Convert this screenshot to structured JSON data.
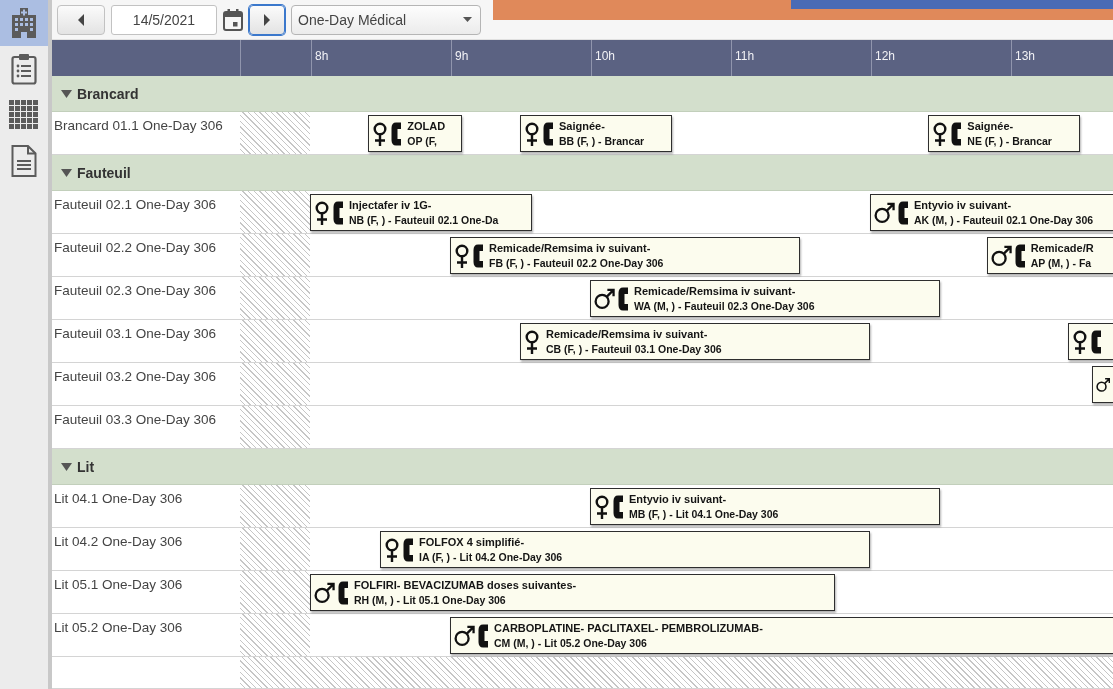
{
  "sidebar": {
    "items": [
      {
        "selected": true
      },
      {
        "selected": false
      },
      {
        "selected": false
      },
      {
        "selected": false
      }
    ]
  },
  "toolbar": {
    "date": "14/5/2021",
    "next_focused": true,
    "unit": "One-Day Médical"
  },
  "timeline": {
    "hours": [
      "8h",
      "9h",
      "10h",
      "11h",
      "12h",
      "13h"
    ]
  },
  "groups": [
    {
      "title": "Brancard",
      "expanded": true,
      "rows": [
        {
          "label": "Brancard 01.1 One-Day 306",
          "unavailable": false,
          "events": [
            {
              "kind": "female",
              "phone": true,
              "title": "ZOLAD",
              "detail": "OP (F,"
            },
            {
              "kind": "female",
              "phone": true,
              "title": "Saignée-",
              "detail": "BB (F, ) - Brancar"
            },
            {
              "kind": "female",
              "phone": true,
              "title": "Saignée-",
              "detail": "NE (F, ) - Brancar"
            }
          ]
        }
      ]
    },
    {
      "title": "Fauteuil",
      "expanded": true,
      "rows": [
        {
          "label": "Fauteuil 02.1 One-Day 306",
          "unavailable": false,
          "events": [
            {
              "kind": "female",
              "phone": true,
              "title": "Injectafer iv 1G-",
              "detail": "NB (F, ) - Fauteuil 02.1 One-Da"
            },
            {
              "kind": "male",
              "phone": true,
              "title": "Entyvio iv suivant-",
              "detail": "AK (M, ) - Fauteuil 02.1 One-Day 306"
            }
          ]
        },
        {
          "label": "Fauteuil 02.2 One-Day 306",
          "unavailable": false,
          "events": [
            {
              "kind": "female",
              "phone": true,
              "title": "Remicade/Remsima iv suivant-",
              "detail": "FB (F, ) - Fauteuil 02.2 One-Day 306"
            },
            {
              "kind": "male",
              "phone": true,
              "title": "Remicade/R",
              "detail": "AP (M, ) - Fa"
            }
          ]
        },
        {
          "label": "Fauteuil 02.3 One-Day 306",
          "unavailable": false,
          "events": [
            {
              "kind": "male",
              "phone": true,
              "title": "Remicade/Remsima iv suivant-",
              "detail": "WA (M, ) - Fauteuil 02.3 One-Day 306"
            }
          ]
        },
        {
          "label": "Fauteuil 03.1 One-Day 306",
          "unavailable": false,
          "events": [
            {
              "kind": "female",
              "phone": false,
              "title": "Remicade/Remsima iv suivant-",
              "detail": "CB (F, ) - Fauteuil 03.1 One-Day 306"
            },
            {
              "kind": "female",
              "phone": true
            }
          ]
        },
        {
          "label": "Fauteuil 03.2 One-Day 306",
          "unavailable": false,
          "events": [
            {
              "kind": "male",
              "phone": false
            }
          ]
        },
        {
          "label": "Fauteuil 03.3 One-Day 306",
          "unavailable": false
        }
      ]
    },
    {
      "title": "Lit",
      "expanded": true,
      "rows": [
        {
          "label": "Lit 04.1 One-Day 306",
          "unavailable": false,
          "events": [
            {
              "kind": "female",
              "phone": true,
              "title": "Entyvio iv suivant-",
              "detail": "MB (F, ) - Lit 04.1 One-Day 306"
            }
          ]
        },
        {
          "label": "Lit 04.2 One-Day 306",
          "unavailable": false,
          "events": [
            {
              "kind": "female",
              "phone": true,
              "title": "FOLFOX 4 simplifié-",
              "detail": "IA (F, ) - Lit 04.2 One-Day 306"
            }
          ]
        },
        {
          "label": "Lit 05.1 One-Day 306",
          "unavailable": false,
          "events": [
            {
              "kind": "male",
              "phone": true,
              "title": "FOLFIRI- BEVACIZUMAB doses suivantes-",
              "detail": "RH (M, ) - Lit 05.1 One-Day 306"
            }
          ]
        },
        {
          "label": "Lit 05.2 One-Day 306",
          "unavailable": false,
          "events": [
            {
              "kind": "male",
              "phone": true,
              "title": "CARBOPLATINE- PACLITAXEL- PEMBROLIZUMAB-",
              "detail": "CM (M, ) - Lit 05.2 One-Day 306"
            }
          ]
        },
        {
          "unavailable": true
        }
      ]
    }
  ]
}
